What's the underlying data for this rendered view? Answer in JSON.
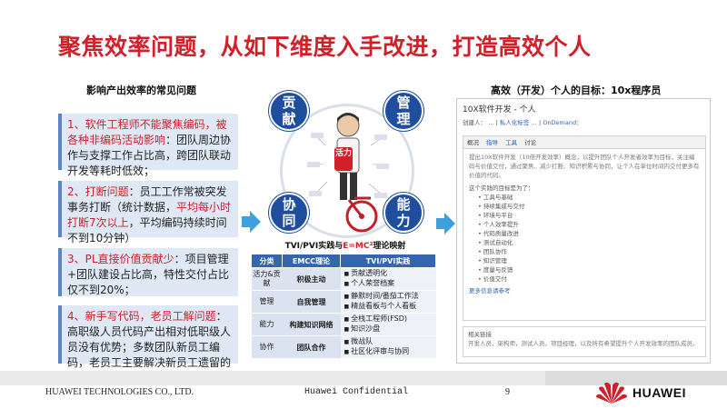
{
  "title": "聚焦效率问题，从如下维度入手改进，打造高效个人",
  "left": {
    "heading": "影响产出效率的常见问题",
    "problems": [
      {
        "highlight": "1、软件工程师不能聚焦编码，被各种非编码活动影响",
        "text": "：团队周边协作与支撑工作占比高，跨团队联动开发等耗时低效；"
      },
      {
        "highlight": "2、打断问题",
        "text": "：员工工作常被突发事务打断（统计数据，",
        "highlight2": "平均每小时打断7次以上",
        "text2": "，平均编码持续时间不到10分钟）"
      },
      {
        "highlight": "3、PL直接价值贡献少",
        "text": "：项目管理+团队建设占比高，特性交付占比仅不到20%；"
      },
      {
        "highlight": "4、新手写代码，老员工解问题",
        "text": "：高职级人员代码产出相对低职级人员没有优势；多数团队新员工编码，老员工主要解决新员工遗留的问题。"
      }
    ]
  },
  "center": {
    "circles": {
      "top_left": "贡献",
      "top_right": "管理",
      "bottom_left": "协同",
      "bottom_right": "能力"
    },
    "badge": "活力",
    "table_title_prefix": "TVI/PVI实践与",
    "table_title_formula": "E=MC²",
    "table_title_suffix": "理论映射",
    "headers": [
      "分类",
      "EMCC理论",
      "TVI/PVI实践"
    ],
    "rows": [
      {
        "cat": "活力&贡献",
        "theory": "积极主动",
        "practices": [
          "贡献透明化",
          "个人荣誉档案"
        ]
      },
      {
        "cat": "管理",
        "theory": "自我管理",
        "practices": [
          "静默时间/番茄工作法",
          "精益看板与个人看板"
        ]
      },
      {
        "cat": "能力",
        "theory": "构建知识网络",
        "practices": [
          "全栈工程师(FSD)",
          "知识沙盘"
        ]
      },
      {
        "cat": "协作",
        "theory": "团队合作",
        "practices": [
          "微战队",
          "社区化评审与协同"
        ]
      }
    ]
  },
  "right": {
    "heading": "高效（开发）个人的目标：10x程序员",
    "shot": {
      "title": "10X软件开发 - 个人",
      "meta_prefix": "创建人：",
      "meta_links": [
        "…",
        "私人化标签",
        "…",
        "OnDemand："
      ],
      "tabs": [
        "概况",
        "指导",
        "工具",
        "讨论"
      ],
      "intro": "提出10X软件开发（10倍开发效率）概念，以提升团队个人开发者效率为目标，关注编码与价值交付，通过聚焦、减少打断、知识积累与协同，让个人在单位时间内交付更多有价值的代码。",
      "list_heading": "这个实践的目标是为了：",
      "items": [
        "工具与基础",
        "持续集成与交付",
        "环境与平台",
        "个人效率提升",
        "代码质量改进",
        "测试自动化",
        "团队协作",
        "知识管理",
        "度量与反馈",
        "价值交付"
      ],
      "more": "更多信息请参考",
      "foot_heading": "相关链接",
      "foot_text": "开发人员，架构师，测试人员，项目经理，以及所有希望提升个人开发效率的团队成员。"
    }
  },
  "footer": {
    "company": "HUAWEI TECHNOLOGIES CO., LTD.",
    "confidential": "Huawei Confidential",
    "page": "9",
    "brand": "HUAWEI"
  },
  "colors": {
    "accent": "#d0202a",
    "brand_blue": "#1f4e9e",
    "problem_bg": "#dfe9f6",
    "arrow": "#3ea0dc"
  }
}
